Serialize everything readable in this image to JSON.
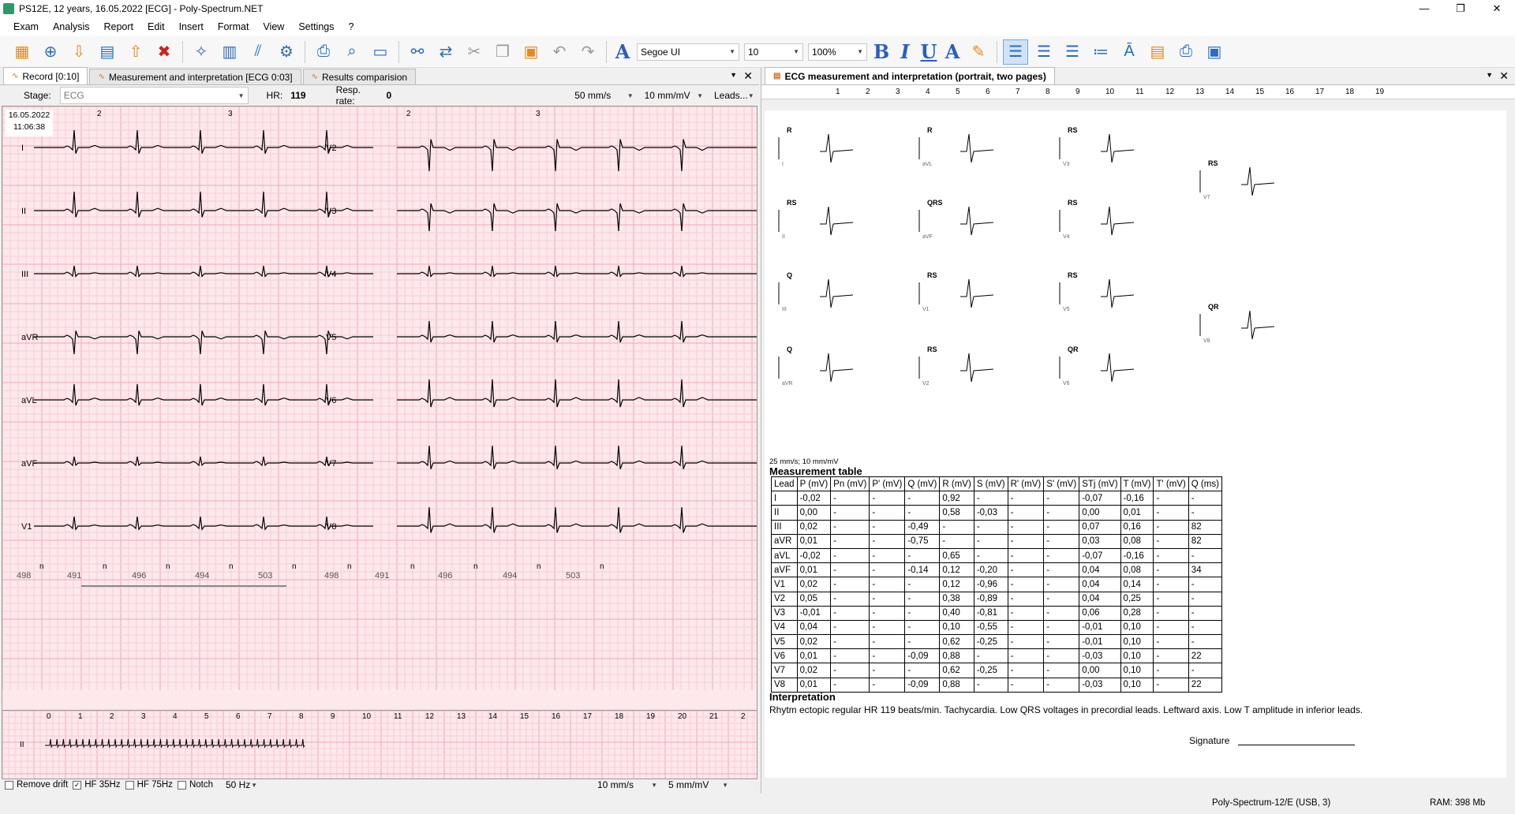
{
  "window": {
    "title": "PS12E, 12 years, 16.05.2022 [ECG] - Poly-Spectrum.NET",
    "controls": [
      "—",
      "❐",
      "✕"
    ]
  },
  "menu": [
    "Exam",
    "Analysis",
    "Report",
    "Edit",
    "Insert",
    "Format",
    "View",
    "Settings",
    "?"
  ],
  "toolbar": {
    "font": "Segoe UI",
    "size": "10",
    "zoom": "100%"
  },
  "left": {
    "tabs": [
      "Record [0:10]",
      "Measurement and interpretation [ECG 0:03]",
      "Results comparision"
    ],
    "stage_label": "Stage:",
    "stage_value": "ECG",
    "hr_label": "HR:",
    "hr_value": "119",
    "resp_label": "Resp. rate:",
    "resp_value": "0",
    "speed": "50 mm/s",
    "gain": "10 mm/mV",
    "leads": "Leads...",
    "date": "16.05.2022",
    "time": "11:06:38",
    "leads_left": [
      "I",
      "II",
      "III",
      "aVR",
      "aVL",
      "aVF",
      "V1"
    ],
    "leads_right": [
      "V2",
      "V3",
      "V4",
      "V5",
      "V6",
      "V7",
      "V8"
    ],
    "top_marks": [
      "2",
      "3",
      "2",
      "3"
    ],
    "rr_intervals": [
      "498",
      "491",
      "496",
      "494",
      "503",
      "498",
      "491",
      "496",
      "494",
      "503"
    ],
    "rhythm_lead": "II",
    "rhythm_ticks": [
      "0",
      "1",
      "2",
      "3",
      "4",
      "5",
      "6",
      "7",
      "8",
      "9",
      "10",
      "11",
      "12",
      "13",
      "14",
      "15",
      "16",
      "17",
      "18",
      "19",
      "20",
      "21",
      "2"
    ],
    "bottom": {
      "remove_drift": "Remove drift",
      "hf35": "HF 35Hz",
      "hf75": "HF 75Hz",
      "notch": "Notch",
      "hz": "50 Hz",
      "speed": "10 mm/s",
      "gain": "5 mm/mV"
    }
  },
  "right": {
    "tab": "ECG measurement and interpretation (portrait, two pages)",
    "ruler": [
      "1",
      "2",
      "3",
      "4",
      "5",
      "6",
      "7",
      "8",
      "9",
      "10",
      "11",
      "12",
      "13",
      "14",
      "15",
      "16",
      "17",
      "18",
      "19"
    ],
    "complexes": [
      {
        "type": "R",
        "lead": "I"
      },
      {
        "type": "R",
        "lead": "aVL"
      },
      {
        "type": "RS",
        "lead": "V3"
      },
      {
        "type": "RS",
        "lead": "V7"
      },
      {
        "type": "RS",
        "lead": "II"
      },
      {
        "type": "QRS",
        "lead": "aVF"
      },
      {
        "type": "RS",
        "lead": "V4"
      },
      {
        "type": "Q",
        "lead": "III"
      },
      {
        "type": "RS",
        "lead": "V1"
      },
      {
        "type": "RS",
        "lead": "V5"
      },
      {
        "type": "QR",
        "lead": "V8"
      },
      {
        "type": "Q",
        "lead": "aVR"
      },
      {
        "type": "RS",
        "lead": "V2"
      },
      {
        "type": "QR",
        "lead": "V6"
      }
    ],
    "scale_note": "25 mm/s; 10 mm/mV",
    "table_title": "Measurement table",
    "table_headers": [
      "Lead",
      "P (mV)",
      "Pn (mV)",
      "P' (mV)",
      "Q (mV)",
      "R (mV)",
      "S (mV)",
      "R' (mV)",
      "S' (mV)",
      "STj (mV)",
      "T (mV)",
      "T' (mV)",
      "Q (ms)"
    ],
    "table_rows": [
      [
        "I",
        "-0,02",
        "-",
        "-",
        "-",
        "0,92",
        "-",
        "-",
        "-",
        "-0,07",
        "-0,16",
        "-",
        "-"
      ],
      [
        "II",
        "0,00",
        "-",
        "-",
        "-",
        "0,58",
        "-0,03",
        "-",
        "-",
        "0,00",
        "0,01",
        "-",
        "-"
      ],
      [
        "III",
        "0,02",
        "-",
        "-",
        "-0,49",
        "-",
        "-",
        "-",
        "-",
        "0,07",
        "0,16",
        "-",
        "82"
      ],
      [
        "aVR",
        "0,01",
        "-",
        "-",
        "-0,75",
        "-",
        "-",
        "-",
        "-",
        "0,03",
        "0,08",
        "-",
        "82"
      ],
      [
        "aVL",
        "-0,02",
        "-",
        "-",
        "-",
        "0,65",
        "-",
        "-",
        "-",
        "-0,07",
        "-0,16",
        "-",
        "-"
      ],
      [
        "aVF",
        "0,01",
        "-",
        "-",
        "-0,14",
        "0,12",
        "-0,20",
        "-",
        "-",
        "0,04",
        "0,08",
        "-",
        "34"
      ],
      [
        "V1",
        "0,02",
        "-",
        "-",
        "-",
        "0,12",
        "-0,96",
        "-",
        "-",
        "0,04",
        "0,14",
        "-",
        "-"
      ],
      [
        "V2",
        "0,05",
        "-",
        "-",
        "-",
        "0,38",
        "-0,89",
        "-",
        "-",
        "0,04",
        "0,25",
        "-",
        "-"
      ],
      [
        "V3",
        "-0,01",
        "-",
        "-",
        "-",
        "0,40",
        "-0,81",
        "-",
        "-",
        "0,06",
        "0,28",
        "-",
        "-"
      ],
      [
        "V4",
        "0,04",
        "-",
        "-",
        "-",
        "0,10",
        "-0,55",
        "-",
        "-",
        "-0,01",
        "0,10",
        "-",
        "-"
      ],
      [
        "V5",
        "0,02",
        "-",
        "-",
        "-",
        "0,62",
        "-0,25",
        "-",
        "-",
        "-0,01",
        "0,10",
        "-",
        "-"
      ],
      [
        "V6",
        "0,01",
        "-",
        "-",
        "-0,09",
        "0,88",
        "-",
        "-",
        "-",
        "-0,03",
        "0,10",
        "-",
        "22"
      ],
      [
        "V7",
        "0,02",
        "-",
        "-",
        "-",
        "0,62",
        "-0,25",
        "-",
        "-",
        "0,00",
        "0,10",
        "-",
        "-"
      ],
      [
        "V8",
        "0,01",
        "-",
        "-",
        "-0,09",
        "0,88",
        "-",
        "-",
        "-",
        "-0,03",
        "0,10",
        "-",
        "22"
      ]
    ],
    "interpretation_title": "Interpretation",
    "interpretation": "Rhytm ectopic regular HR 119 beats/min. Tachycardia. Low QRS voltages in precordial leads. Leftward axis. Low T amplitude in inferior leads.",
    "signature": "Signature"
  },
  "status": {
    "device": "Poly-Spectrum-12/E (USB, 3)",
    "ram": "RAM: 398 Mb"
  }
}
